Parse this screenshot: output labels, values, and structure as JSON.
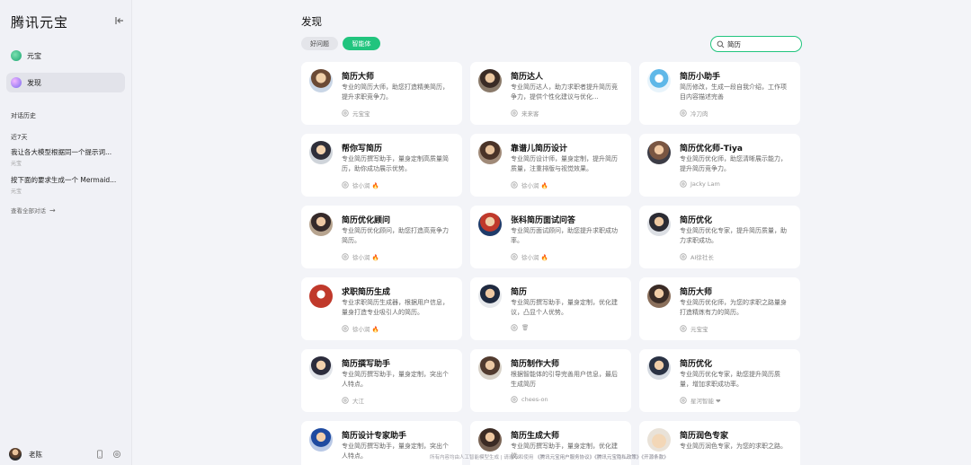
{
  "app": {
    "brand": "腾讯元宝"
  },
  "sidebar": {
    "nav": [
      {
        "label": "元宝",
        "icon": "yuanbao-icon"
      },
      {
        "label": "发现",
        "icon": "discover-icon"
      }
    ],
    "history_label": "对话历史",
    "section_label": "近7天",
    "history": [
      {
        "title": "我让各大模型根据同一个提示词...",
        "sub": "元宝"
      },
      {
        "title": "按下面的要求生成一个 Mermaid...",
        "sub": "元宝"
      }
    ],
    "view_all": "查看全部对话",
    "user": {
      "name": "老陈"
    }
  },
  "main": {
    "title": "发现",
    "tabs": [
      {
        "label": "好问题",
        "active": false
      },
      {
        "label": "智能体",
        "active": true
      }
    ],
    "search": {
      "value": "简历",
      "placeholder": ""
    },
    "cards": [
      {
        "title": "简历大师",
        "desc": "专业的简历大师，助您打造精美简历，提升求职竞争力。",
        "author": "元宝宝"
      },
      {
        "title": "简历达人",
        "desc": "专业简历达人，助力求职者提升简历竞争力，提供个性化建议与优化...",
        "author": "来来客"
      },
      {
        "title": "简历小助手",
        "desc": "简历修改，生成一段自我介绍，工作项目内容描述完善",
        "author": "冷刀肉"
      },
      {
        "title": "帮你写简历",
        "desc": "专业简历撰写助手，量身定制高质量简历，助你成功展示优势。",
        "author": "徐小润 🔥"
      },
      {
        "title": "靠谱儿简历设计",
        "desc": "专业简历设计师，量身定制，提升简历质量，注重排版与视觉效果。",
        "author": "徐小润 🔥"
      },
      {
        "title": "简历优化师-Tiya",
        "desc": "专业简历优化师，助您清晰展示能力，提升简历竞争力。",
        "author": "Jacky Lam"
      },
      {
        "title": "简历优化顾问",
        "desc": "专业简历优化顾问，助您打造高竞争力简历。",
        "author": "徐小润 🔥"
      },
      {
        "title": "张科简历面试问答",
        "desc": "专业简历面试顾问，助您提升求职成功率。",
        "author": "徐小润 🔥"
      },
      {
        "title": "简历优化",
        "desc": "专业简历优化专家，提升简历质量，助力求职成功。",
        "author": "AI徐社长"
      },
      {
        "title": "求职简历生成",
        "desc": "专业求职简历生成器，根据用户信息，量身打造专业吸引人的简历。",
        "author": "徐小润 🔥"
      },
      {
        "title": "简历",
        "desc": "专业简历撰写助手，量身定制，优化建议，凸显个人优势。",
        "author": "🗑"
      },
      {
        "title": "简历大师",
        "desc": "专业简历优化师，为您的求职之路量身打造精炼有力的简历。",
        "author": "元宝宝"
      },
      {
        "title": "简历撰写助手",
        "desc": "专业简历撰写助手，量身定制，突出个人特点。",
        "author": "大江"
      },
      {
        "title": "简历制作大师",
        "desc": "根据智能体的引导完善用户信息，最后生成简历",
        "author": "chees-on"
      },
      {
        "title": "简历优化",
        "desc": "专业简历优化专家，助您提升简历质量，增加求职成功率。",
        "author": "星河智能 ❤"
      },
      {
        "title": "简历设计专家助手",
        "desc": "专业简历撰写助手，量身定制，突出个人特点。",
        "author": ""
      },
      {
        "title": "简历生成大师",
        "desc": "专业简历撰写助手，量身定制，优化建议。",
        "author": ""
      },
      {
        "title": "简历润色专家",
        "desc": "专业简历润色专家，为您的求职之路。",
        "author": ""
      }
    ],
    "footer": {
      "text": "所有内容均由人工智能模型生成  |  请遵守和使用",
      "links": "《腾讯元宝用户服务协议》《腾讯元宝隐私政策》《开源条款》"
    }
  }
}
